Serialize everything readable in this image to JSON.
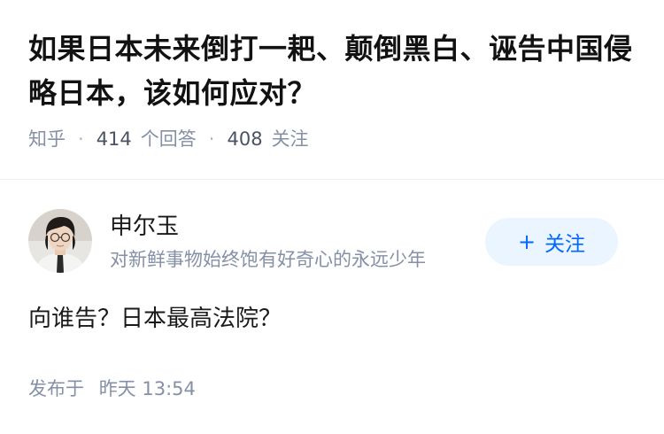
{
  "question": {
    "title": "如果日本未来倒打一耙、颠倒黑白、诬告中国侵略日本，该如何应对？",
    "source": "知乎",
    "answer_count": "414",
    "answer_label": "个回答",
    "follower_count": "408",
    "follower_label": "关注"
  },
  "author": {
    "name": "申尔玉",
    "bio": "对新鲜事物始终饱有好奇心的永远少年",
    "follow_label": "关注",
    "follow_plus": "+"
  },
  "answer": {
    "text": "向谁告？日本最高法院？",
    "published_prefix": "发布于",
    "published_time": "昨天 13:54"
  },
  "colors": {
    "accent": "#0066ff",
    "accent_bg": "#ebf5ff",
    "meta_text": "#8590a6"
  },
  "icons": {
    "avatar": "user-avatar-photo"
  }
}
